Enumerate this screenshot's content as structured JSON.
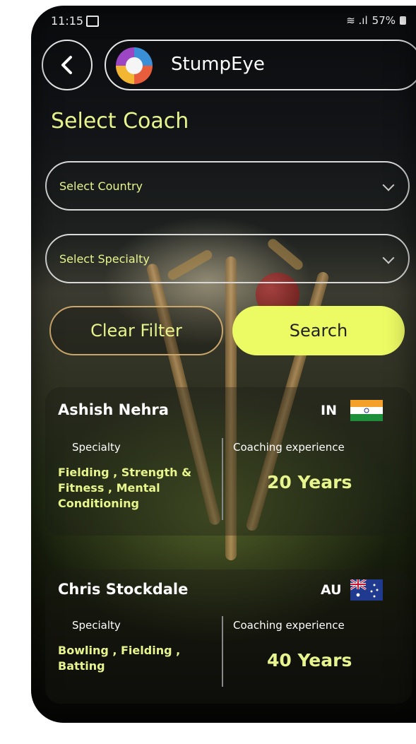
{
  "status": {
    "time": "11:15",
    "battery": "57%"
  },
  "header": {
    "app_name": "StumpEye"
  },
  "page_title": "Select Coach",
  "filters": {
    "country_placeholder": "Select Country",
    "specialty_placeholder": "Select Specialty"
  },
  "buttons": {
    "clear": "Clear Filter",
    "search": "Search"
  },
  "coaches": [
    {
      "name": "Ashish Nehra",
      "country": "IN",
      "specialty_label": "Specialty",
      "specialty": "Fielding , Strength & Fitness , Mental Conditioning",
      "experience_label": "Coaching experience",
      "experience": "20 Years"
    },
    {
      "name": "Chris Stockdale",
      "country": "AU",
      "specialty_label": "Specialty",
      "specialty": "Bowling , Fielding , Batting",
      "experience_label": "Coaching experience",
      "experience": "40 Years"
    }
  ],
  "colors": {
    "accent": "#e7f58c",
    "button": "#ecfa64"
  }
}
